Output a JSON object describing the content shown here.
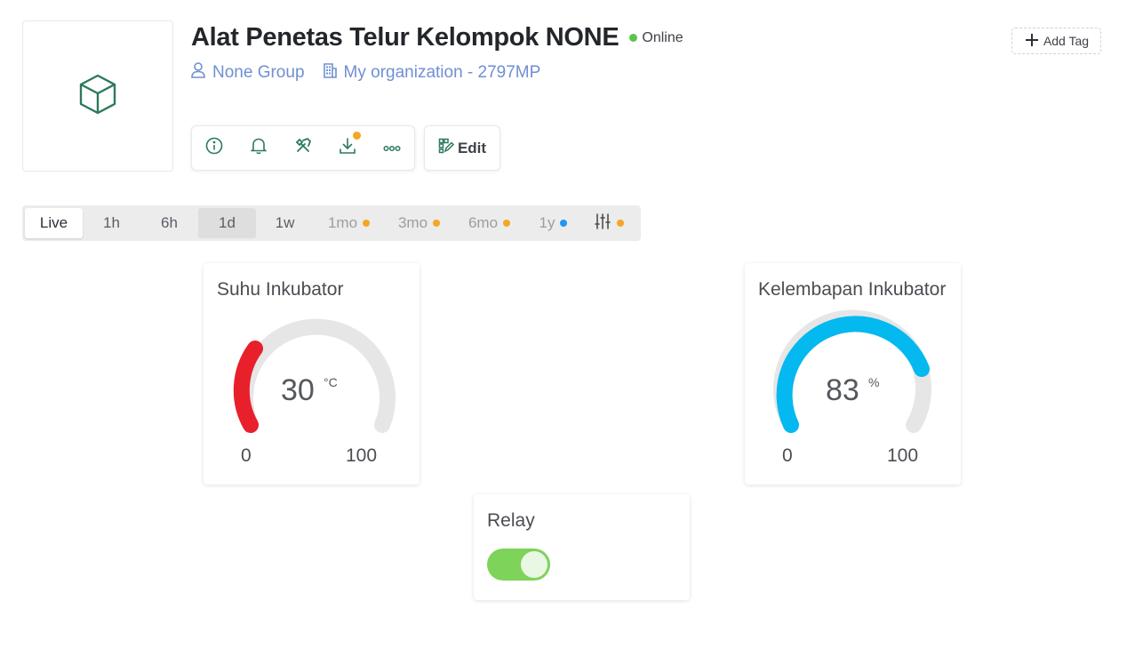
{
  "device": {
    "name": "Alat Penetas Telur Kelompok NONE",
    "status": "Online",
    "group": "None Group",
    "organization": "My organization - 2797MP",
    "icon": "cube-icon"
  },
  "header": {
    "add_tag_label": "Add Tag",
    "edit_label": "Edit"
  },
  "actions": [
    {
      "name": "info-icon"
    },
    {
      "name": "bell-icon"
    },
    {
      "name": "tools-icon"
    },
    {
      "name": "download-icon",
      "badge": true
    },
    {
      "name": "more-icon"
    }
  ],
  "time_ranges": [
    {
      "label": "Live",
      "state": "active"
    },
    {
      "label": "1h",
      "state": "normal"
    },
    {
      "label": "6h",
      "state": "normal"
    },
    {
      "label": "1d",
      "state": "selected"
    },
    {
      "label": "1w",
      "state": "normal"
    },
    {
      "label": "1mo",
      "state": "disabled",
      "dot_color": "#f5a623"
    },
    {
      "label": "3mo",
      "state": "disabled",
      "dot_color": "#f5a623"
    },
    {
      "label": "6mo",
      "state": "disabled",
      "dot_color": "#f5a623"
    },
    {
      "label": "1y",
      "state": "disabled",
      "dot_color": "#2196f3"
    }
  ],
  "custom_range_dot_color": "#f5a623",
  "widgets": {
    "temperature": {
      "title": "Suhu Inkubator",
      "value": "30",
      "unit": "°C",
      "min": "0",
      "max": "100",
      "color": "#e8202c"
    },
    "humidity": {
      "title": "Kelembapan Inkubator",
      "value": "83",
      "unit": "%",
      "min": "0",
      "max": "100",
      "color": "#04b8f0"
    },
    "relay": {
      "title": "Relay",
      "state": "on",
      "color": "#7ed35a"
    }
  },
  "colors": {
    "accent_green": "#2c7a5b",
    "link_blue": "#6f8fd4",
    "online": "#5cc34d"
  }
}
